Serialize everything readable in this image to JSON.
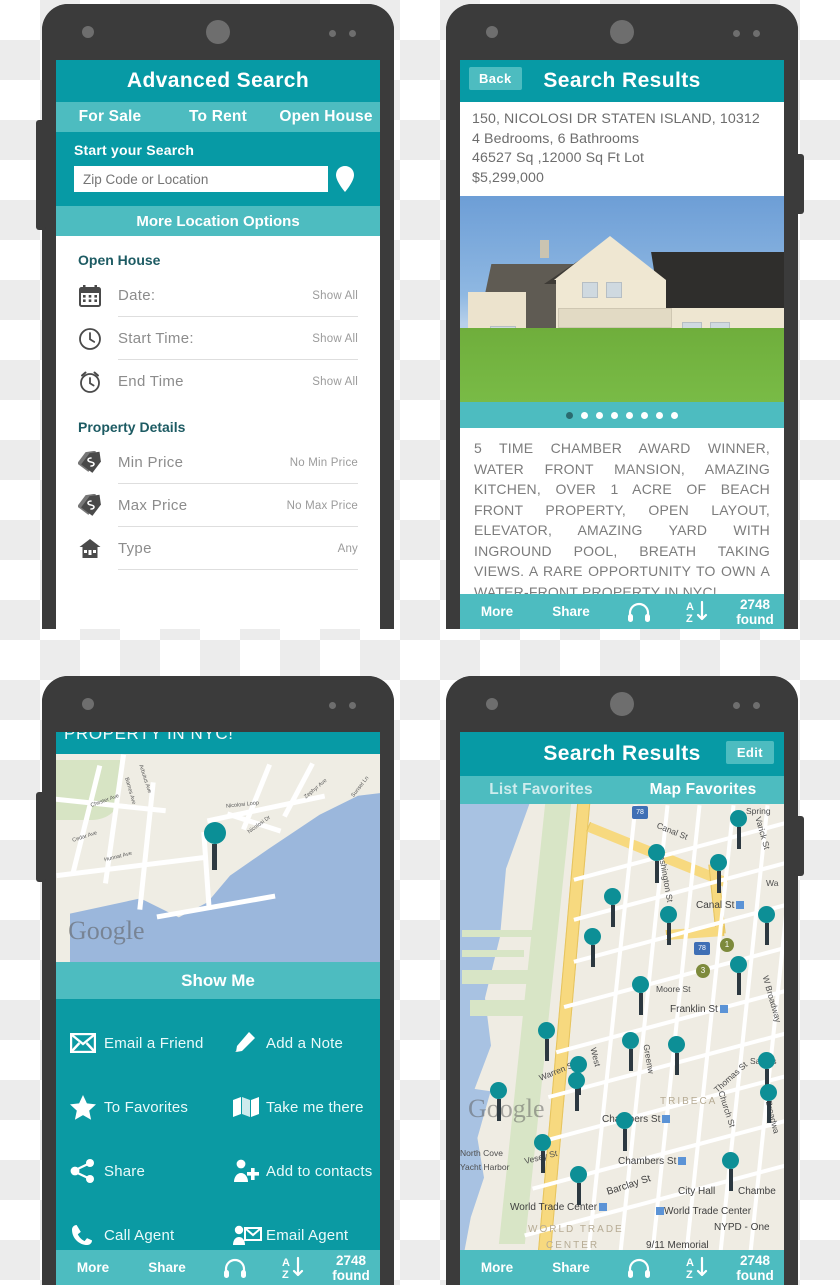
{
  "colors": {
    "teal_dark": "#079aa5",
    "teal_light": "#4dbcc0",
    "teal_action": "#0b9aa3",
    "bezel": "#3b3b3b",
    "marker": "#0d8f96"
  },
  "phone1": {
    "title": "Advanced Search",
    "tabs": [
      {
        "label": "For Sale"
      },
      {
        "label": "To Rent"
      },
      {
        "label": "Open House"
      }
    ],
    "search": {
      "label": "Start your Search",
      "placeholder": "Zip Code or Location",
      "value": "",
      "pin_icon": "map-pin-icon"
    },
    "more_location_options": "More Location Options",
    "sections": [
      {
        "heading": "Open House",
        "rows": [
          {
            "icon": "calendar-icon",
            "name": "Date:",
            "value": "Show All"
          },
          {
            "icon": "clock-icon",
            "name": "Start Time:",
            "value": "Show All"
          },
          {
            "icon": "alarm-clock-icon",
            "name": "End Time",
            "value": "Show All"
          }
        ]
      },
      {
        "heading": "Property Details",
        "rows": [
          {
            "icon": "price-tag-icon",
            "name": "Min Price",
            "value": "No Min Price"
          },
          {
            "icon": "price-tag-icon",
            "name": "Max Price",
            "value": "No Max Price"
          },
          {
            "icon": "house-icon",
            "name": "Type",
            "value": "Any"
          }
        ]
      }
    ]
  },
  "phone2": {
    "back_label": "Back",
    "title": "Search Results",
    "listing": {
      "address": "150, NICOLOSI DR STATEN ISLAND, 10312",
      "beds_baths": "4 Bedrooms, 6 Bathrooms",
      "size": "46527 Sq ,12000 Sq Ft Lot",
      "price": "$5,299,000"
    },
    "gallery": {
      "total_dots": 8,
      "active_index": 0
    },
    "description": "5 TIME CHAMBER AWARD WINNER, WATER FRONT MANSION, AMAZING KITCHEN, OVER 1 ACRE OF BEACH FRONT PROPERTY, OPEN LAYOUT, ELEVATOR, AMAZING YARD WITH INGROUND POOL, BREATH TAKING VIEWS. A RARE OPPORTUNITY TO OWN A WATER-FRONT PROPERTY IN NYC!",
    "bottom_bar": {
      "more": "More",
      "share": "Share",
      "headphones_icon": "headphones-icon",
      "sort_icon": "sort-az-icon",
      "found": "2748 found"
    }
  },
  "phone3": {
    "carryover_text": "PROPERTY IN NYC!",
    "map": {
      "attribution": "Google",
      "labels": [
        "Arbutus Ave",
        "Bames Ave",
        "Cedar Ave",
        "Nicolosi Loop",
        "Nicolosi Dr",
        "Zephyr Ave",
        "Hunnat Ave",
        "Chester Ave",
        "Sunset Ln"
      ]
    },
    "show_me": "Show Me",
    "actions": [
      {
        "icon": "envelope-icon",
        "label": "Email a Friend"
      },
      {
        "icon": "pencil-icon",
        "label": "Add a Note"
      },
      {
        "icon": "star-icon",
        "label": "To Favorites"
      },
      {
        "icon": "folded-map-icon",
        "label": "Take me there"
      },
      {
        "icon": "share-nodes-icon",
        "label": "Share"
      },
      {
        "icon": "add-contact-icon",
        "label": "Add to contacts"
      },
      {
        "icon": "phone-icon",
        "label": "Call Agent"
      },
      {
        "icon": "contact-envelope-icon",
        "label": "Email Agent"
      }
    ],
    "bottom_bar": {
      "more": "More",
      "share": "Share",
      "headphones_icon": "headphones-icon",
      "sort_icon": "sort-az-icon",
      "found": "2748 found"
    }
  },
  "phone4": {
    "title": "Search Results",
    "edit_label": "Edit",
    "tabs": [
      {
        "label": "List Favorites"
      },
      {
        "label": "Map Favorites"
      }
    ],
    "map": {
      "attribution": "Google",
      "labels": [
        "Spring",
        "Canal St",
        "Varick St",
        "Washington St",
        "Canal St",
        "Wa",
        "Moore St",
        "Franklin St",
        "W Broadway",
        "Santos",
        "Thomas St",
        "Church St",
        "TRIBECA",
        "Broadwa",
        "Warren St",
        "West",
        "Greenw",
        "Chambers St",
        "Chambers St",
        "Vesey St",
        "Barclay St",
        "City Hall",
        "Chambe",
        "World Trade Center",
        "World Trade Center",
        "NYPD - One",
        "9/11 Memorial",
        "North Cove",
        "Yacht Harbor",
        "WORLD TRADE",
        "CENTER"
      ],
      "route_shields": [
        "78",
        "78"
      ],
      "route_circles": [
        "1",
        "3"
      ]
    },
    "bottom_bar": {
      "more": "More",
      "share": "Share",
      "headphones_icon": "headphones-icon",
      "sort_icon": "sort-az-icon",
      "found": "2748 found"
    }
  }
}
